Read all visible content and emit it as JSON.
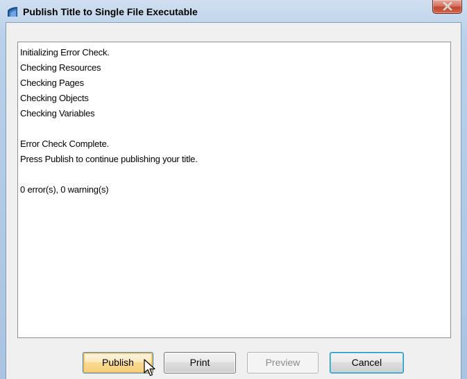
{
  "window": {
    "title": "Publish Title to Single File Executable",
    "app_icon": "app-icon",
    "close_icon": "close-icon"
  },
  "log": {
    "lines": [
      "Initializing Error Check.",
      "Checking Resources",
      "Checking Pages",
      "Checking Objects",
      "Checking Variables",
      "",
      "Error Check Complete.",
      "Press Publish to continue publishing your title.",
      "",
      "0 error(s), 0 warning(s)"
    ]
  },
  "buttons": {
    "publish": "Publish",
    "print": "Print",
    "preview": "Preview",
    "cancel": "Cancel"
  },
  "colors": {
    "close_red": "#c3452e",
    "frame_blue": "#b9d0ea",
    "hover_orange": "#f9d98f"
  }
}
